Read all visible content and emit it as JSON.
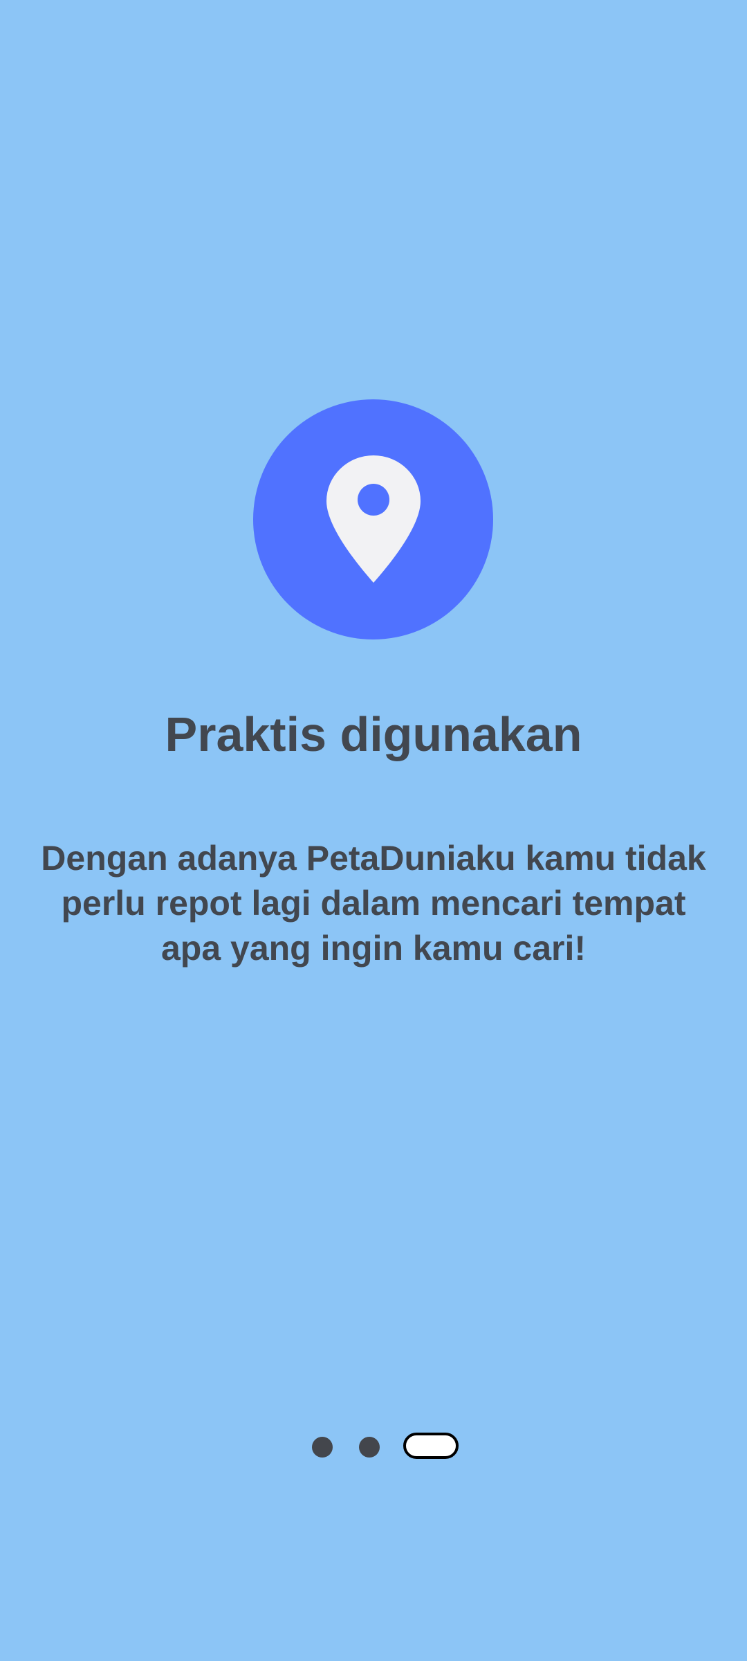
{
  "colors": {
    "background": "#8CC5F6",
    "icon_circle": "#5072FF",
    "pin": "#F2F2F4",
    "text": "#42474F",
    "dot_inactive": "#43464C",
    "dot_active_fill": "#FFFFFF",
    "dot_active_border": "#000000"
  },
  "icon": {
    "name": "location-pin-icon"
  },
  "onboarding": {
    "title": "Praktis digunakan",
    "description": "Dengan adanya PetaDuniaku kamu tidak perlu repot lagi dalam mencari tempat apa yang ingin kamu cari!"
  },
  "pager": {
    "total_pages": 3,
    "current_page": 3
  }
}
